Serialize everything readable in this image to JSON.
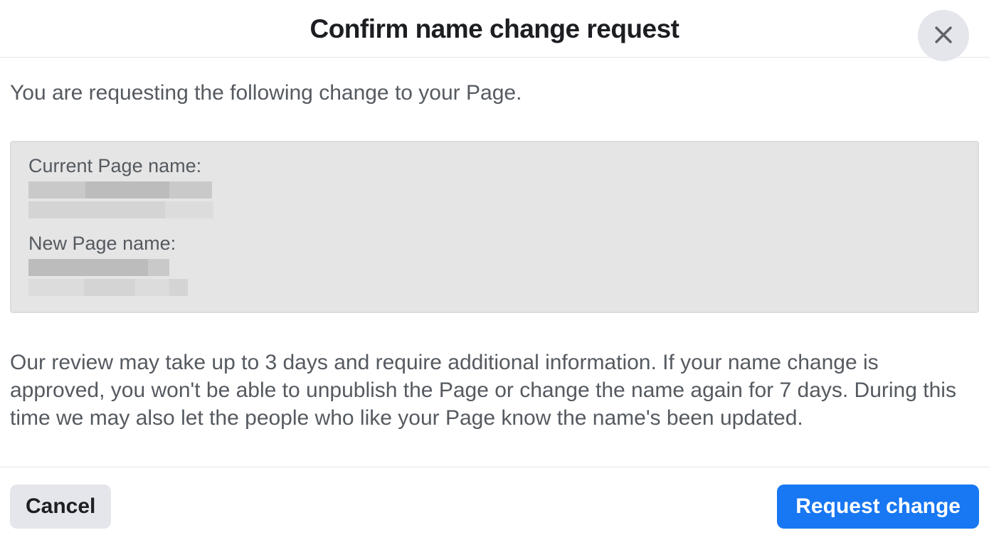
{
  "header": {
    "title": "Confirm name change request"
  },
  "body": {
    "intro": "You are requesting the following change to your Page.",
    "current_label": "Current Page name:",
    "new_label": "New Page name:",
    "info": "Our review may take up to 3 days and require additional information. If your name change is approved, you won't be able to unpublish the Page or change the name again for 7 days. During this time we may also let the people who like your Page know the name's been updated."
  },
  "footer": {
    "cancel_label": "Cancel",
    "request_label": "Request change"
  }
}
